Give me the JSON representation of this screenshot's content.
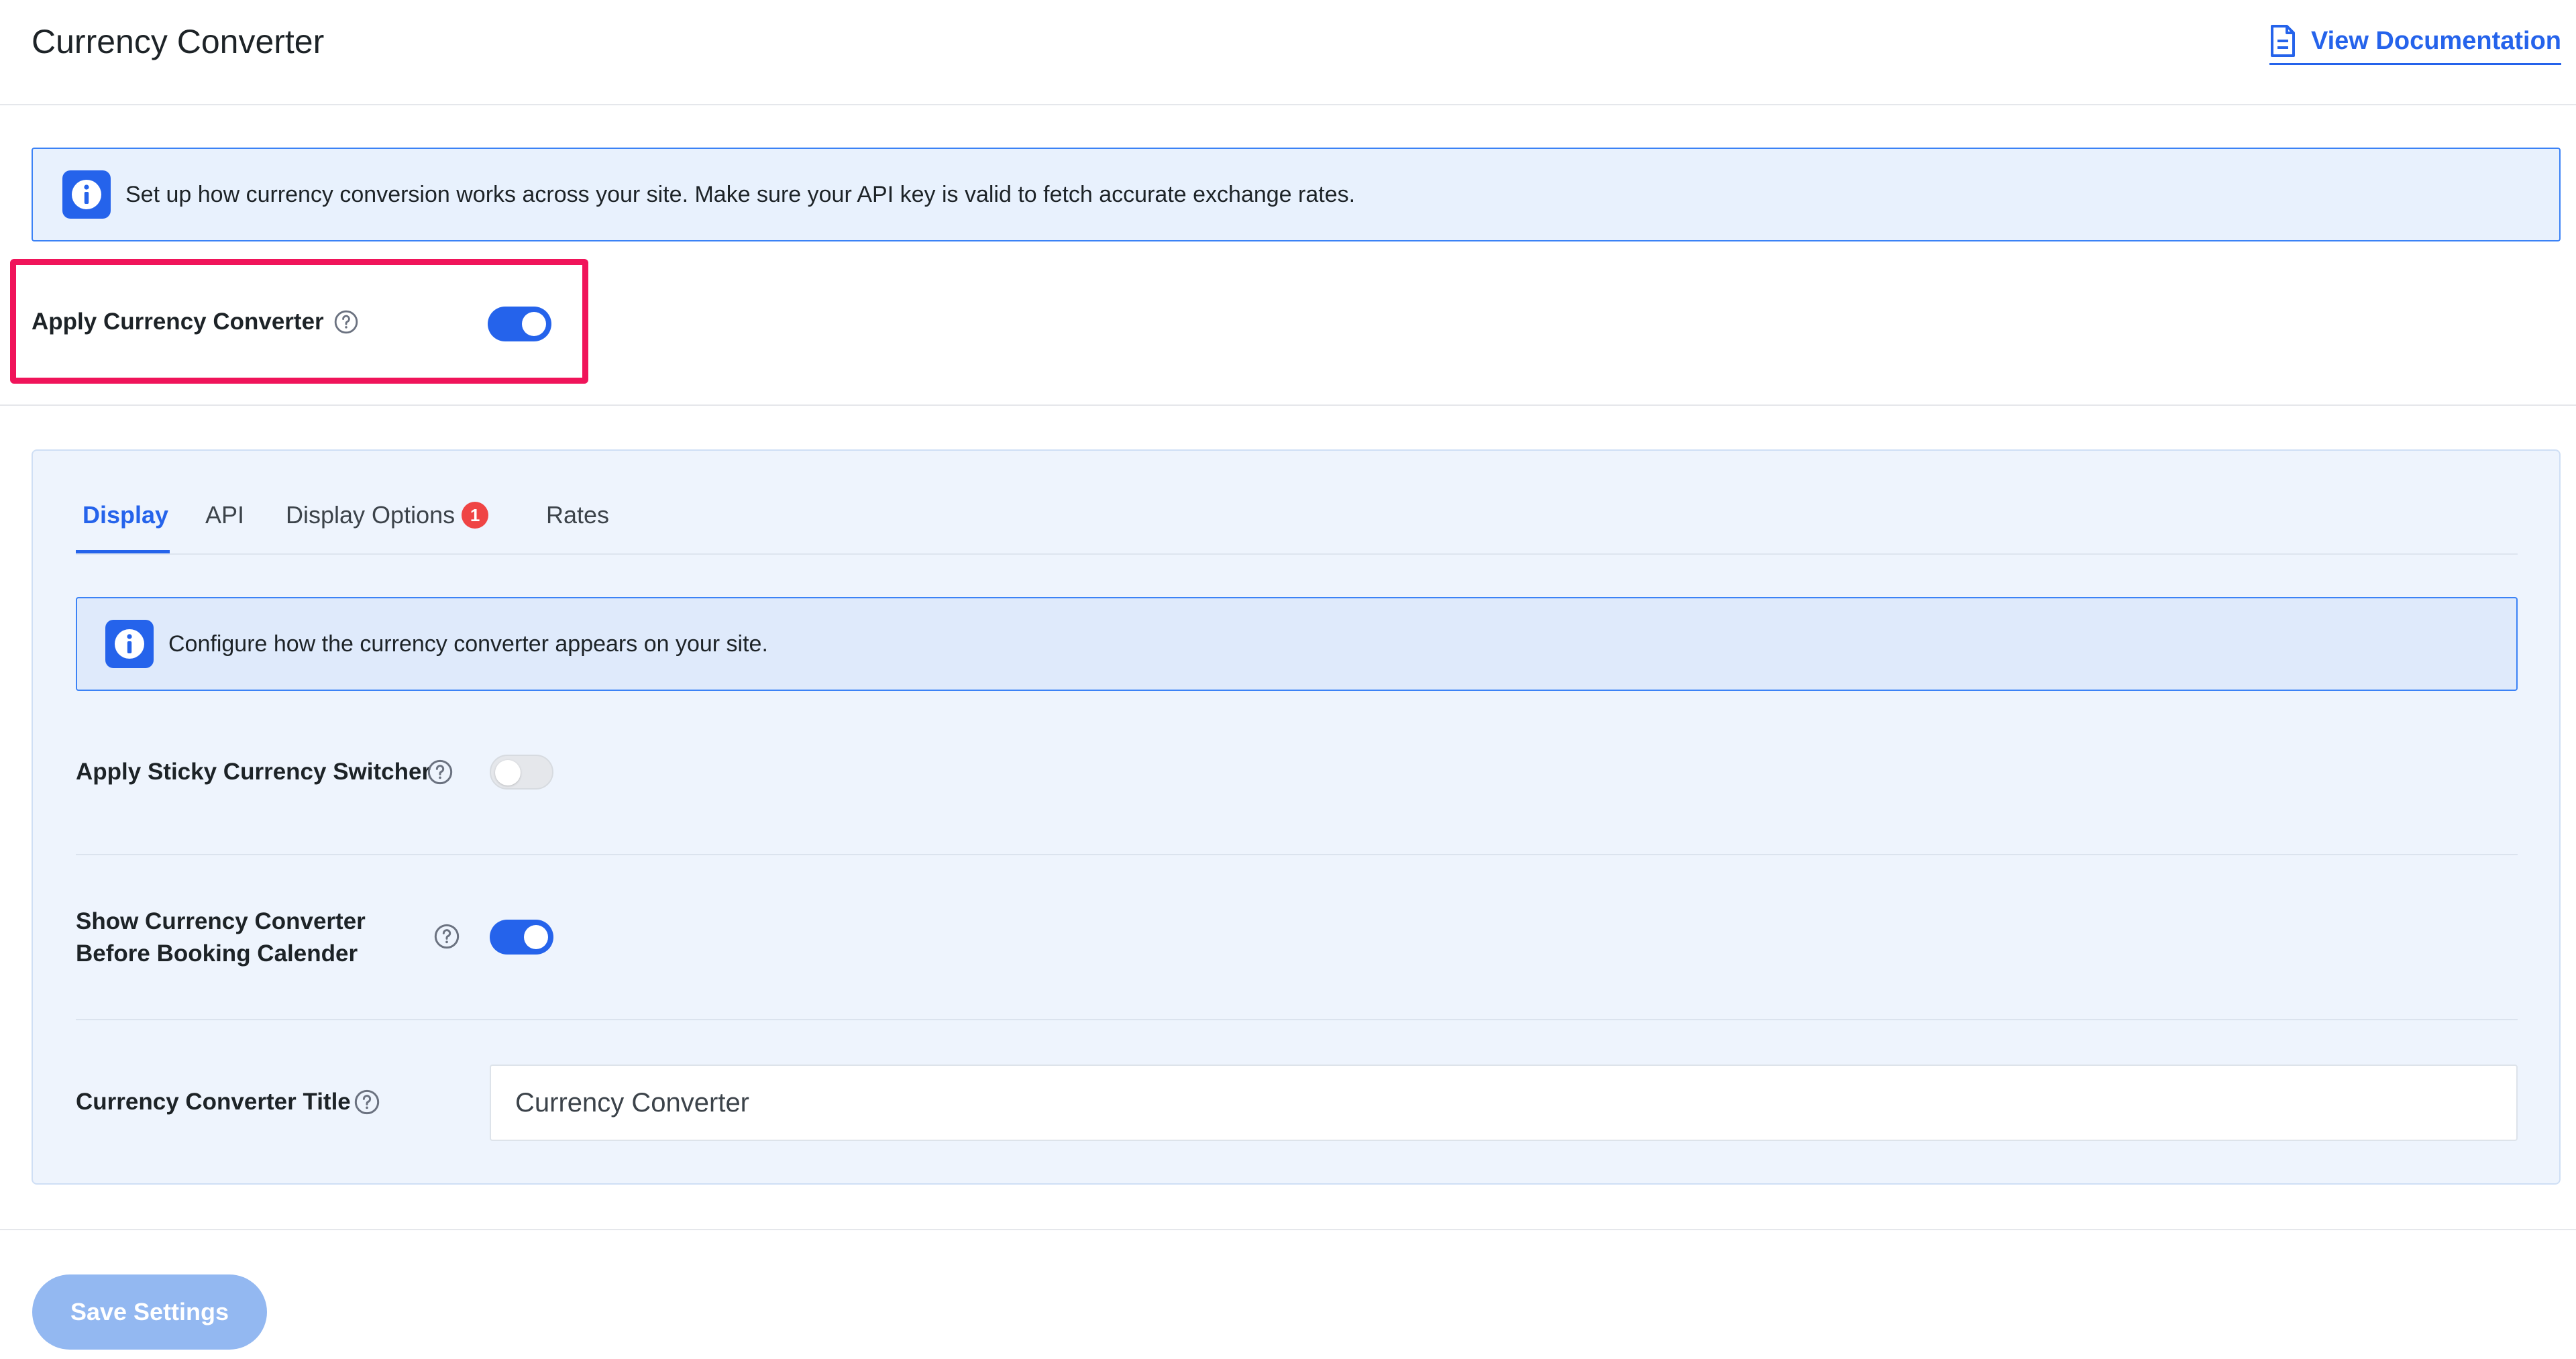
{
  "header": {
    "title": "Currency Converter",
    "doc_link": "View Documentation"
  },
  "notice_top": "Set up how currency conversion works across your site. Make sure your API key is valid to fetch accurate exchange rates.",
  "apply_currency_converter": {
    "label": "Apply Currency Converter",
    "enabled": true
  },
  "tabs": [
    {
      "label": "Display",
      "active": true
    },
    {
      "label": "API",
      "active": false
    },
    {
      "label": "Display Options",
      "badge": "1",
      "active": false
    },
    {
      "label": "Rates",
      "active": false
    }
  ],
  "display": {
    "notice": "Configure how the currency converter appears on your site.",
    "sticky_switcher": {
      "label": "Apply Sticky Currency Switcher",
      "enabled": false
    },
    "show_before_calendar": {
      "label_line1": "Show Currency Converter",
      "label_line2": "Before Booking Calender",
      "enabled": true
    },
    "converter_title": {
      "label": "Currency Converter Title",
      "value": "Currency Converter"
    }
  },
  "save_button": "Save Settings",
  "colors": {
    "accent": "#2563eb",
    "highlight": "#f0145a",
    "badge": "#ef4444",
    "save_disabled": "#93b8f1"
  },
  "icons": [
    "document-icon",
    "info-icon",
    "help-icon"
  ]
}
